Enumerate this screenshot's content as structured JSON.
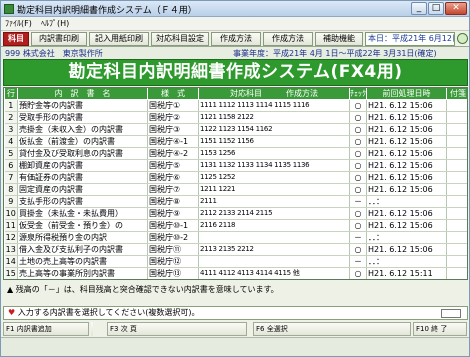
{
  "window": {
    "title": "勘定科目内訳明細書作成システム（Ｆ４用）",
    "controls": {
      "minimize": "_",
      "maximize": "□",
      "close": "✕"
    }
  },
  "menu": {
    "file": "ﾌｧｲﾙ(F)",
    "help": "ﾍﾙﾌﾟ(H)"
  },
  "toolbar": {
    "kamoku": "科目",
    "print": "内訳書印刷",
    "kinyu_print": "記入用紙印刷",
    "taio": "対応科目設定",
    "method": "作成方法",
    "sakusei": "作成方法",
    "help": "補助機能",
    "date": "本日：平成21年 6月12日(金)"
  },
  "info": {
    "company": "999 株式会社　東京製作所",
    "period": "事業年度：平成21年 4月 1日〜平成22年 3月31日(確定)"
  },
  "banner": "勘定科目内訳明細書作成システム(FX4用)",
  "table": {
    "headers": {
      "row": "行",
      "name": "内　訳　書　名",
      "form": "様　式",
      "codes": "対応科目",
      "method": "作成方法",
      "check": "ﾁｪｯｸ",
      "last": "前回処理日時",
      "attach": "付箋"
    },
    "rows": [
      {
        "no": "1",
        "name": "預貯金等の内訳書",
        "form": "国税庁①",
        "codes": "1111 1112 1113 1114 1115 1116",
        "check": "○",
        "date": "H21. 6.12 15:06"
      },
      {
        "no": "2",
        "name": "受取手形の内訳書",
        "form": "国税庁②",
        "codes": "1121 1158 2122",
        "check": "○",
        "date": "H21. 6.12 15:06"
      },
      {
        "no": "3",
        "name": "売掛金（未収入金）の内訳書",
        "form": "国税庁③",
        "codes": "1122 1123 1154 1162",
        "check": "○",
        "date": "H21. 6.12 15:06"
      },
      {
        "no": "4",
        "name": "仮払金（前渡金）の内訳書",
        "form": "国税庁④-1",
        "codes": "1151 1152 1156",
        "check": "○",
        "date": "H21. 6.12 15:06"
      },
      {
        "no": "5",
        "name": "貸付金及び受取利息の内訳書",
        "form": "国税庁④-2",
        "codes": "1153 1256",
        "check": "○",
        "date": "H21. 6.12 15:06"
      },
      {
        "no": "6",
        "name": "棚卸資産の内訳書",
        "form": "国税庁⑤",
        "codes": "1131 1132 1133 1134 1135 1136",
        "check": "○",
        "date": "H21. 6.12 15:06"
      },
      {
        "no": "7",
        "name": "有価証券の内訳書",
        "form": "国税庁⑥",
        "codes": "1125 1252",
        "check": "○",
        "date": "H21. 6.12 15:06"
      },
      {
        "no": "8",
        "name": "固定資産の内訳書",
        "form": "国税庁⑦",
        "codes": "1211 1221",
        "check": "○",
        "date": "H21. 6.12 15:06"
      },
      {
        "no": "9",
        "name": "支払手形の内訳書",
        "form": "国税庁⑧",
        "codes": "2111",
        "check": "－",
        "date": "．．："
      },
      {
        "no": "10",
        "name": "買掛金（未払金・未払費用）",
        "form": "国税庁⑨",
        "codes": "2112 2133 2114 2115",
        "check": "○",
        "date": "H21. 6.12 15:06"
      },
      {
        "no": "11",
        "name": "仮受金（前受金・預り金）の",
        "form": "国税庁⑩-1",
        "codes": "2116 2118",
        "check": "○",
        "date": "H21. 6.12 15:06"
      },
      {
        "no": "12",
        "name": "源泉所得税預り金の内訳",
        "form": "国税庁⑩-2",
        "codes": "",
        "check": "－",
        "date": "．．："
      },
      {
        "no": "13",
        "name": "借入金及び支払利子の内訳書",
        "form": "国税庁⑪",
        "codes": "2113 2135 2212",
        "check": "○",
        "date": "H21. 6.12 15:06"
      },
      {
        "no": "14",
        "name": "土地の売上高等の内訳書",
        "form": "国税庁⑫",
        "codes": "",
        "check": "－",
        "date": "．．："
      },
      {
        "no": "15",
        "name": "売上高等の事業所別内訳書",
        "form": "国税庁⑬",
        "codes": "4111 4112 4113 4114 4115 他",
        "check": "○",
        "date": "H21. 6.12 15:11"
      }
    ]
  },
  "notice": "残高の「－」は、科目残高と突合確認できない内訳書を意味しています。",
  "prompt": "入力する内訳書を選択してください(複数選択可)。",
  "fkeys": {
    "f1": "F1 内訳書追加",
    "f3": "F3 次 頁",
    "f6": "F6 全選択",
    "f10": "F10 終 了"
  },
  "icons": {
    "notice": "triangle-up",
    "prompt": "heart"
  },
  "colors": {
    "banner": "#2e9a2e",
    "header": "#3a9a3a",
    "selected_tab": "#b21e1e"
  }
}
